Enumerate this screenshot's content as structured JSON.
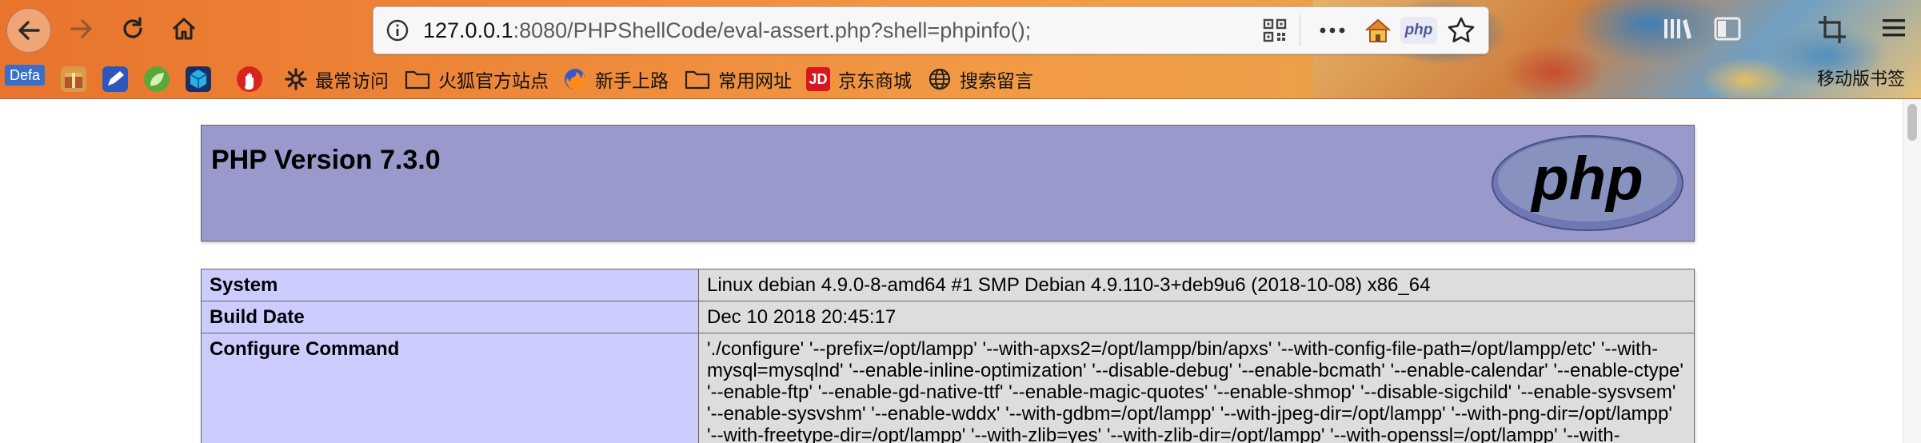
{
  "browser": {
    "url_host": "127.0.0.1",
    "url_rest": ":8080/PHPShellCode/eval-assert.php?shell=phpinfo();",
    "php_ext_label": "php",
    "bookmarks": {
      "defa_chip": "Defa",
      "items": [
        {
          "label": "最常访问",
          "icon": "gear-icon"
        },
        {
          "label": "火狐官方站点",
          "icon": "folder-icon"
        },
        {
          "label": "新手上路",
          "icon": "firefox-icon"
        },
        {
          "label": "常用网址",
          "icon": "folder-icon"
        },
        {
          "label": "京东商城",
          "icon": "jd-icon",
          "icon_text": "JD"
        },
        {
          "label": "搜索留言",
          "icon": "globe-icon"
        }
      ],
      "mobile": "移动版书签"
    }
  },
  "page": {
    "header_title": "PHP Version 7.3.0",
    "logo_text": "php",
    "rows": [
      {
        "key": "System",
        "value": "Linux debian 4.9.0-8-amd64 #1 SMP Debian 4.9.110-3+deb9u6 (2018-10-08) x86_64"
      },
      {
        "key": "Build Date",
        "value": "Dec 10 2018 20:45:17"
      },
      {
        "key": "Configure Command",
        "value": "'./configure' '--prefix=/opt/lampp' '--with-apxs2=/opt/lampp/bin/apxs' '--with-config-file-path=/opt/lampp/etc' '--with-mysql=mysqlnd' '--enable-inline-optimization' '--disable-debug' '--enable-bcmath' '--enable-calendar' '--enable-ctype' '--enable-ftp' '--enable-gd-native-ttf' '--enable-magic-quotes' '--enable-shmop' '--disable-sigchild' '--enable-sysvsem' '--enable-sysvshm' '--enable-wddx' '--with-gdbm=/opt/lampp' '--with-jpeg-dir=/opt/lampp' '--with-png-dir=/opt/lampp' '--with-freetype-dir=/opt/lampp' '--with-zlib=yes' '--with-zlib-dir=/opt/lampp' '--with-openssl=/opt/lampp' '--with-"
      }
    ]
  },
  "colors": {
    "header_bg": "#9999cc",
    "key_cell_bg": "#ccccff",
    "value_cell_bg": "#dddddd"
  }
}
